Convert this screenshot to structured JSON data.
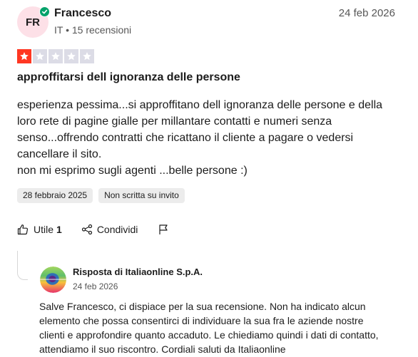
{
  "reviewer": {
    "initials": "FR",
    "name": "Francesco",
    "country": "IT",
    "separator": "•",
    "reviews_count": "15 recensioni"
  },
  "review": {
    "date": "24 feb 2026",
    "rating": 1,
    "rating_max": 5,
    "title": "approffitarsi dell ignoranza delle persone",
    "body_paragraphs": [
      "esperienza pessima...si approffitano dell ignoranza delle persone e della loro rete di pagine gialle per millantare contatti e numeri senza senso...offrendo contratti che ricattano il cliente a pagare o vedersi cancellare il sito.",
      "non mi esprimo sugli agenti ...belle persone :)"
    ],
    "tags": [
      "28 febbraio 2025",
      "Non scritta su invito"
    ]
  },
  "actions": {
    "useful_label": "Utile",
    "useful_count": "1",
    "share_label": "Condividi"
  },
  "reply": {
    "title": "Risposta di Italiaonline S.p.A.",
    "date": "24 feb 2026",
    "body": "Salve Francesco, ci dispiace per la sua recensione. Non ha indicato alcun elemento che possa consentirci di individuare la sua fra le aziende nostre clienti e approfondire quanto accaduto. Le chiediamo quindi i dati di contatto, attendiamo il suo riscontro. Cordiali saluti da Italiaonline"
  },
  "colors": {
    "star_on": "#ff3722",
    "star_off": "#dcdce6",
    "verified": "#04a26a",
    "avatar_bg": "#fde0e7"
  },
  "icons": [
    "verified-check-icon",
    "star-icon",
    "thumbs-up-icon",
    "share-icon",
    "flag-icon",
    "italiaonline-logo"
  ]
}
